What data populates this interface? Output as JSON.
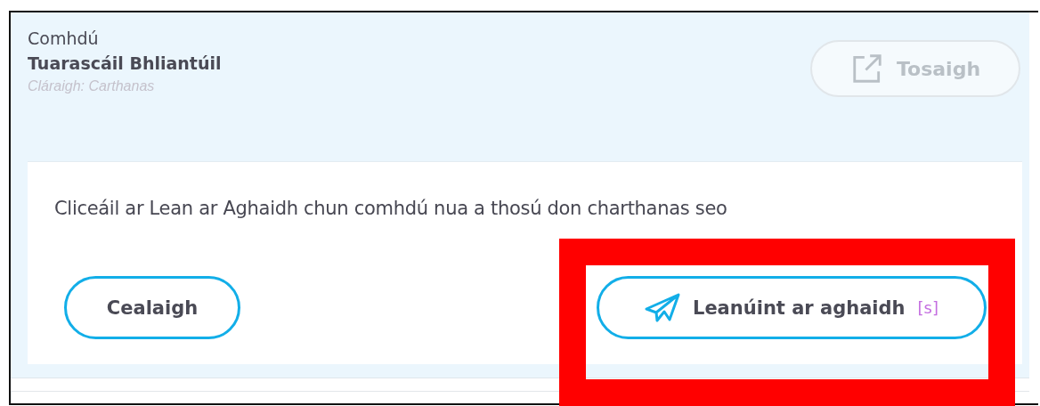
{
  "header": {
    "title": "Comhdú",
    "subtitle": "Tuarascáil Bhliantúil",
    "category": "Cláraigh: Carthanas"
  },
  "start_button": {
    "label": "Tosaigh",
    "disabled": true
  },
  "dialog": {
    "message": "Cliceáil ar Lean ar Aghaidh chun comhdú nua a thosú don charthanas seo",
    "cancel_button": {
      "label": "Cealaigh"
    },
    "continue_button": {
      "label": "Leanúint ar aghaidh",
      "shortcut": "[s]",
      "highlighted": true
    }
  }
}
